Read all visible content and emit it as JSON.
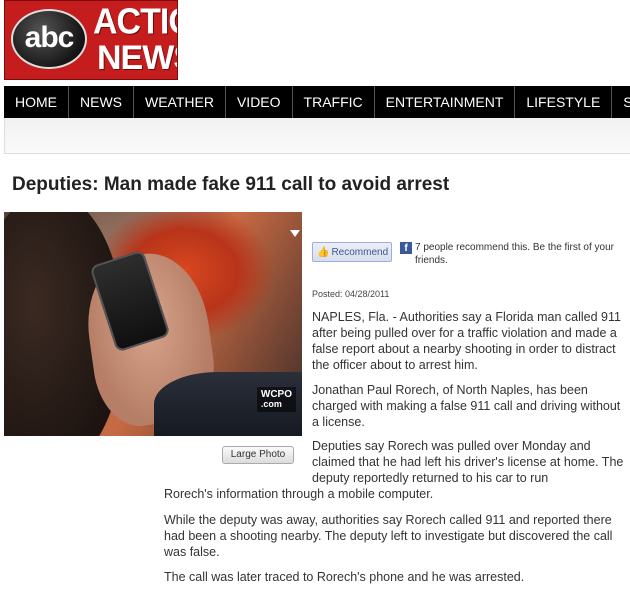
{
  "logo": {
    "network": "abc",
    "line1": "ACTION",
    "line2": "NEWS"
  },
  "nav": {
    "items": [
      "HOME",
      "NEWS",
      "WEATHER",
      "VIDEO",
      "TRAFFIC",
      "ENTERTAINMENT",
      "LIFESTYLE",
      "SPORTS"
    ]
  },
  "article": {
    "headline": "Deputies: Man made fake 911 call to avoid arrest",
    "photo": {
      "watermark_line1": "WCPO",
      "watermark_line2": ".com",
      "large_photo_label": "Large Photo"
    },
    "social": {
      "recommend_label": "Recommend",
      "fb_icon": "f",
      "recommend_text": "7 people recommend this. Be the first of your friends."
    },
    "posted": "Posted: 04/28/2011",
    "paragraphs": [
      "NAPLES, Fla. - Authorities say a Florida man called 911 after being pulled over for a traffic violation and made a false report about a nearby shooting in order to distract the officer about to arrest him.",
      "Jonathan Paul Rorech, of North Naples, has been charged with making a false 911 call and driving without a license.",
      "Deputies say Rorech was pulled over Monday and claimed that he had left his driver's license at home. The deputy reportedly returned to his car to run",
      "Rorech's information through a mobile computer.",
      "While the deputy was away, authorities say Rorech called 911 and reported there had been a shooting nearby. The deputy left to investigate but discovered the call was false.",
      "The call was later traced to Rorech's phone and he was arrested."
    ]
  },
  "colors": {
    "brand_red": "#c51d1d",
    "nav_bg": "#000000",
    "facebook_blue": "#3b5998"
  }
}
